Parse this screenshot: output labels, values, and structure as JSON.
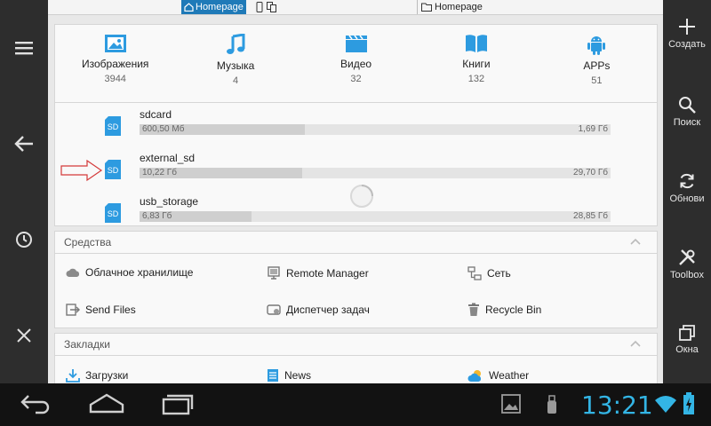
{
  "pathbar": {
    "tab_active": "Homepage",
    "tab_other": "Homepage"
  },
  "right_rail": {
    "items": [
      {
        "label": "Создать",
        "icon": "plus-icon"
      },
      {
        "label": "Поиск",
        "icon": "search-icon"
      },
      {
        "label": "Обнови",
        "icon": "refresh-icon"
      },
      {
        "label": "Toolbox",
        "icon": "toolbox-icon"
      },
      {
        "label": "Окна",
        "icon": "windows-icon"
      }
    ]
  },
  "left_rail": {
    "icons": [
      "menu-icon",
      "back-arrow-icon",
      "history-icon",
      "close-icon"
    ]
  },
  "categories": [
    {
      "label": "Изображения",
      "count": "3944",
      "icon": "image-icon"
    },
    {
      "label": "Музыка",
      "count": "4",
      "icon": "music-icon"
    },
    {
      "label": "Видео",
      "count": "32",
      "icon": "video-icon"
    },
    {
      "label": "Книги",
      "count": "132",
      "icon": "book-icon"
    },
    {
      "label": "APPs",
      "count": "51",
      "icon": "android-icon"
    }
  ],
  "storages": [
    {
      "name": "sdcard",
      "used": "600,50 Мб",
      "total": "1,69 Гб",
      "fill": 0.35
    },
    {
      "name": "external_sd",
      "used": "10,22 Гб",
      "total": "29,70 Гб",
      "fill": 0.345
    },
    {
      "name": "usb_storage",
      "used": "6,83 Гб",
      "total": "28,85 Гб",
      "fill": 0.237
    }
  ],
  "sdicon_label": "SD",
  "tools": {
    "title": "Средства",
    "items": [
      {
        "label": "Облачное хранилище",
        "icon": "cloud-icon"
      },
      {
        "label": "Remote Manager",
        "icon": "remote-manager-icon"
      },
      {
        "label": "Сеть",
        "icon": "network-icon"
      },
      {
        "label": "Send Files",
        "icon": "send-files-icon"
      },
      {
        "label": "Диспетчер задач",
        "icon": "task-manager-icon"
      },
      {
        "label": "Recycle Bin",
        "icon": "recycle-bin-icon"
      }
    ]
  },
  "bookmarks": {
    "title": "Закладки",
    "items": [
      {
        "label": "Загрузки",
        "icon": "download-icon"
      },
      {
        "label": "News",
        "icon": "news-icon"
      },
      {
        "label": "Weather",
        "icon": "weather-icon"
      }
    ]
  },
  "statusbar": {
    "time": "13:21"
  },
  "colors": {
    "accent": "#1f7ab8",
    "clock": "#33b5e5",
    "icon_blue": "#2d9be0"
  }
}
